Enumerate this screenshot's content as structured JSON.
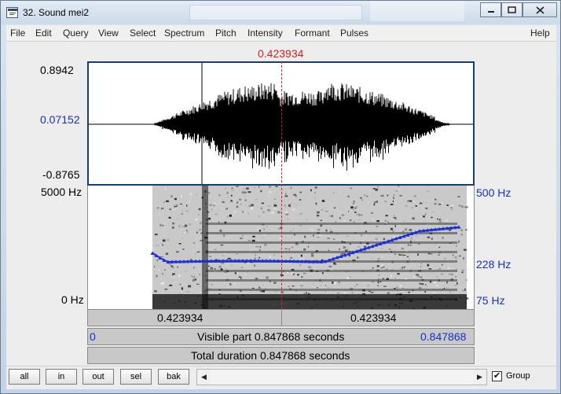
{
  "window": {
    "title": "32. Sound mei2",
    "minimize_icon": "minimize-icon",
    "maximize_icon": "maximize-icon",
    "close_icon": "close-icon"
  },
  "menu": [
    "File",
    "Edit",
    "Query",
    "View",
    "Select",
    "Spectrum",
    "Pitch",
    "Intensity",
    "Formant",
    "Pulses",
    "Help"
  ],
  "cursor_time": "0.423934",
  "waveform": {
    "y_max": "0.8942",
    "y_mid": "0.07152",
    "y_min": "-0.8765"
  },
  "spectrogram": {
    "freq_max": "5000 Hz",
    "freq_min": "0 Hz",
    "pitch_max": "500 Hz",
    "pitch_mid": "228 Hz",
    "pitch_min": "75 Hz",
    "pitch_contour_color": "#1a2fd6"
  },
  "time_bar": {
    "left": "0.423934",
    "right": "0.423934"
  },
  "visible_bar": {
    "start": "0",
    "label": "Visible part 0.847868 seconds",
    "end": "0.847868"
  },
  "total_bar": {
    "label": "Total duration 0.847868 seconds"
  },
  "buttons": {
    "all": "all",
    "in": "in",
    "out": "out",
    "sel": "sel",
    "bak": "bak"
  },
  "group": {
    "label": "Group",
    "checked": true,
    "check_mark": "✔"
  },
  "colors": {
    "cursor": "#d81e1e",
    "axis_blue": "#1630c8"
  }
}
